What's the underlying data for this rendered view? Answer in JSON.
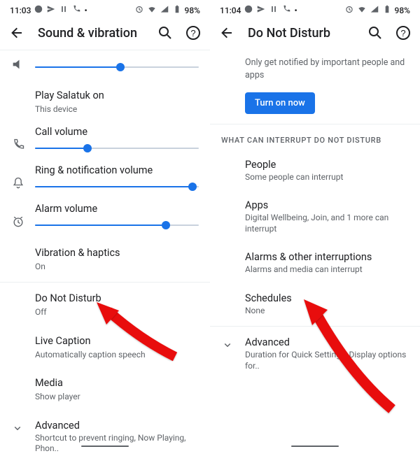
{
  "left": {
    "status_time": "11:03",
    "status_battery": "98%",
    "title": "Sound & vibration",
    "slider_top_pct": 52,
    "play_on": {
      "label": "Play Salatuk on",
      "sub": "This device"
    },
    "call_volume": {
      "label": "Call volume",
      "pct": 32
    },
    "ring_volume": {
      "label": "Ring & notification volume",
      "pct": 96
    },
    "alarm_volume": {
      "label": "Alarm volume",
      "pct": 80
    },
    "vibration": {
      "label": "Vibration & haptics",
      "sub": "On"
    },
    "dnd": {
      "label": "Do Not Disturb",
      "sub": "Off"
    },
    "live_caption": {
      "label": "Live Caption",
      "sub": "Automatically caption speech"
    },
    "media": {
      "label": "Media",
      "sub": "Show player"
    },
    "advanced": {
      "label": "Advanced",
      "sub": "Shortcut to prevent ringing, Now Playing, Phon.."
    }
  },
  "right": {
    "status_time": "11:04",
    "status_battery": "98%",
    "title": "Do Not Disturb",
    "intro": "Only get notified by important people and apps",
    "turn_on": "Turn on now",
    "section": "WHAT CAN INTERRUPT DO NOT DISTURB",
    "people": {
      "label": "People",
      "sub": "Some people can interrupt"
    },
    "apps": {
      "label": "Apps",
      "sub": "Digital Wellbeing, Join, and 1 more can interrupt"
    },
    "alarms": {
      "label": "Alarms & other interruptions",
      "sub": "Alarms and media can interrupt"
    },
    "schedules": {
      "label": "Schedules",
      "sub": "None"
    },
    "advanced": {
      "label": "Advanced",
      "sub": "Duration for Quick Settings, Display options for.."
    }
  }
}
